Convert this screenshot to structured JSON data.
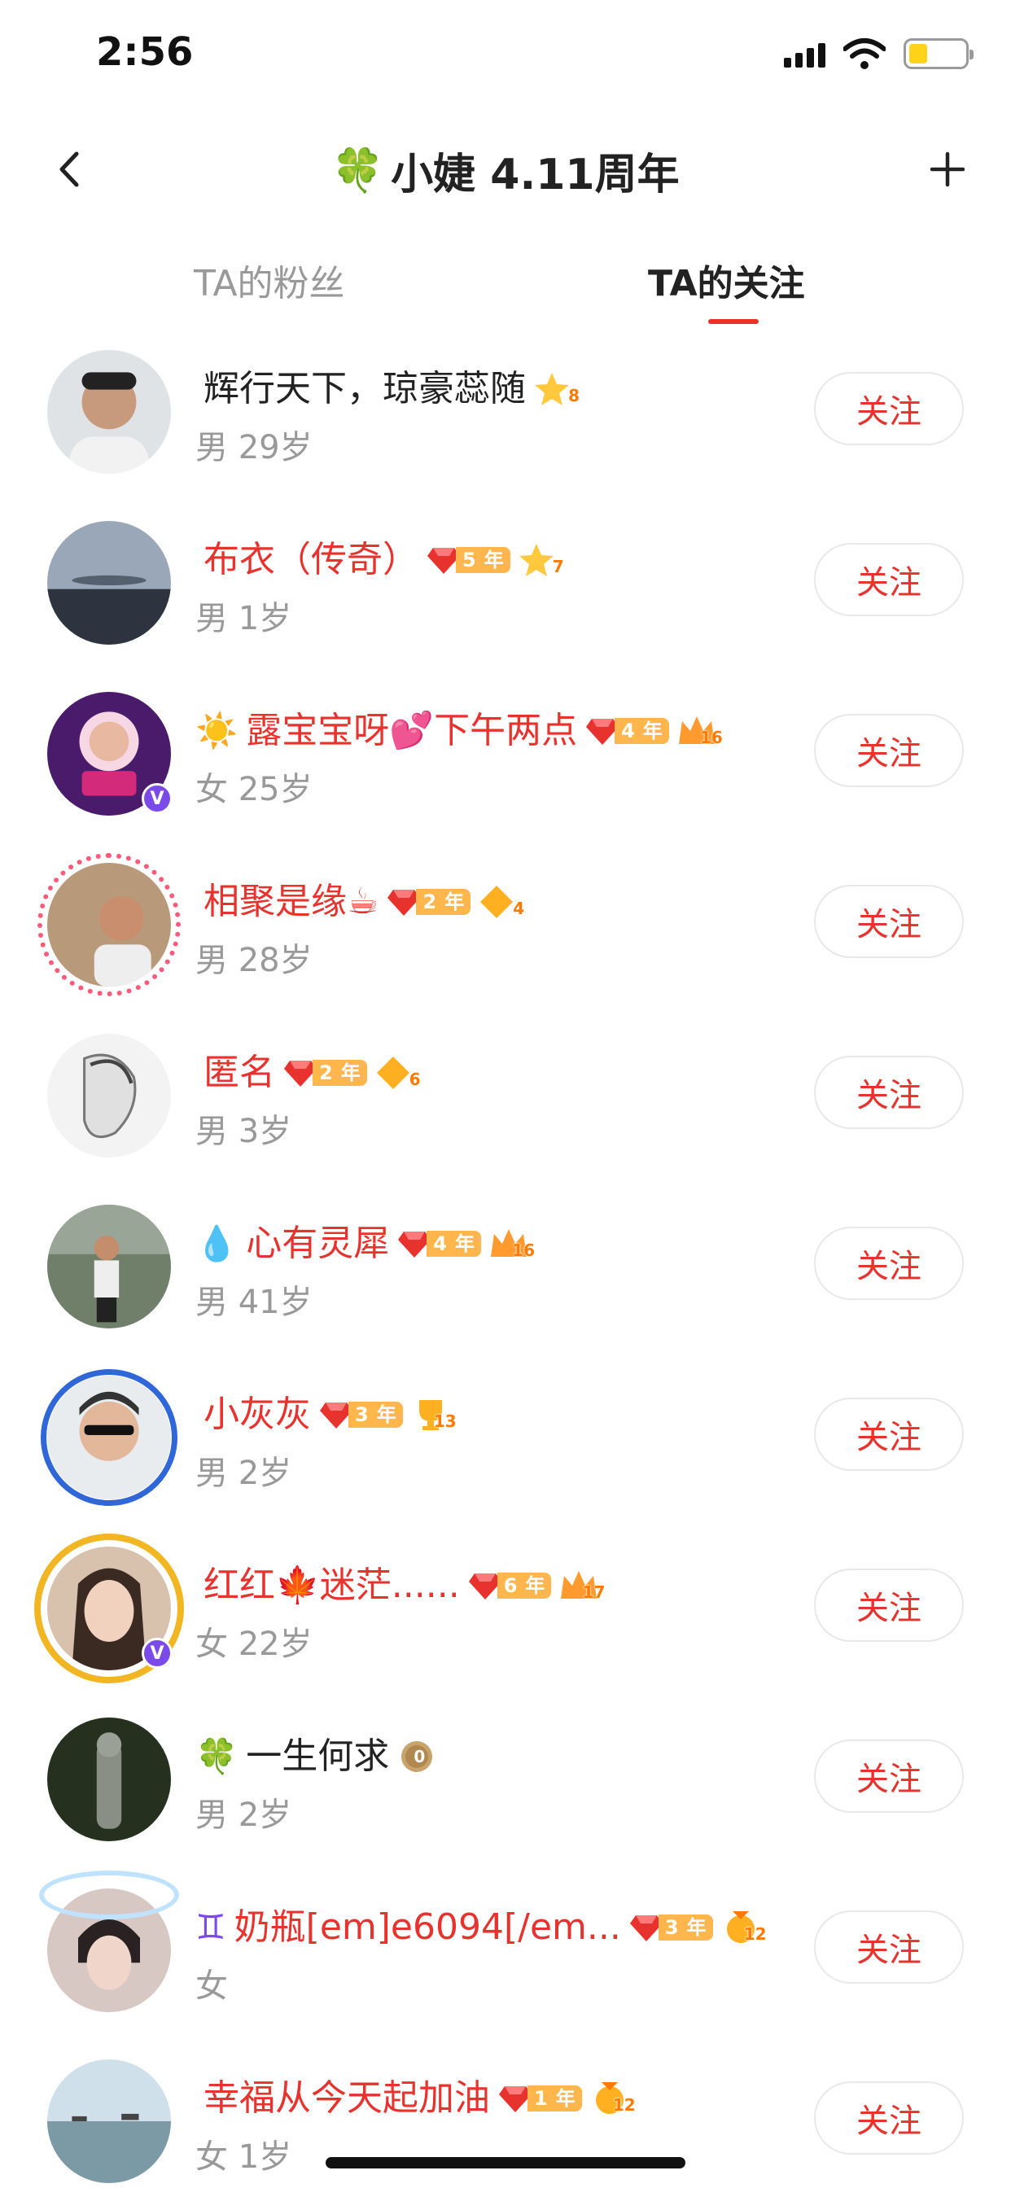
{
  "status_bar": {
    "time": "2:56"
  },
  "nav": {
    "title_emoji": "🍀",
    "title": "小婕 4.11周年"
  },
  "tabs": [
    {
      "label": "TA的粉丝"
    },
    {
      "label": "TA的关注"
    }
  ],
  "follow_label": "关注",
  "users": [
    {
      "prefix": "",
      "name": "辉行天下，琼豪蕊随",
      "red": false,
      "year": "",
      "level": "8",
      "level_icon": "star",
      "gender_age": "男 29岁"
    },
    {
      "prefix": "",
      "name": "布衣（传奇）",
      "red": true,
      "year": "5",
      "level": "7",
      "level_icon": "star",
      "gender_age": "男 1岁"
    },
    {
      "prefix": "☀️",
      "name": "露宝宝呀💕下午两点",
      "red": true,
      "year": "4",
      "level": "16",
      "level_icon": "crown",
      "gender_age": "女 25岁"
    },
    {
      "prefix": "",
      "name": "相聚是缘☕",
      "red": true,
      "year": "2",
      "level": "4",
      "level_icon": "diamond",
      "gender_age": "男 28岁"
    },
    {
      "prefix": "",
      "name": "匿名",
      "red": true,
      "year": "2",
      "level": "6",
      "level_icon": "diamond",
      "gender_age": "男 3岁"
    },
    {
      "prefix": "💧",
      "name": "心有灵犀",
      "red": true,
      "year": "4",
      "level": "16",
      "level_icon": "crown",
      "gender_age": "男 41岁"
    },
    {
      "prefix": "",
      "name": "小灰灰",
      "red": true,
      "year": "3",
      "level": "13",
      "level_icon": "trophy",
      "gender_age": "男 2岁"
    },
    {
      "prefix": "",
      "name": "红红🍁迷茫......",
      "red": true,
      "year": "6",
      "level": "17",
      "level_icon": "crown",
      "gender_age": "女 22岁"
    },
    {
      "prefix": "🍀",
      "name": "一生何求",
      "red": false,
      "year": "",
      "level": "0",
      "level_icon": "coin",
      "gender_age": "男 2岁"
    },
    {
      "prefix": "♊",
      "name": "奶瓶[em]e6094[/em...",
      "red": true,
      "year": "3",
      "level": "12",
      "level_icon": "medal",
      "gender_age": "女"
    },
    {
      "prefix": "",
      "name": "幸福从今天起加油",
      "red": true,
      "year": "1",
      "level": "12",
      "level_icon": "medal",
      "gender_age": "女 1岁"
    }
  ]
}
